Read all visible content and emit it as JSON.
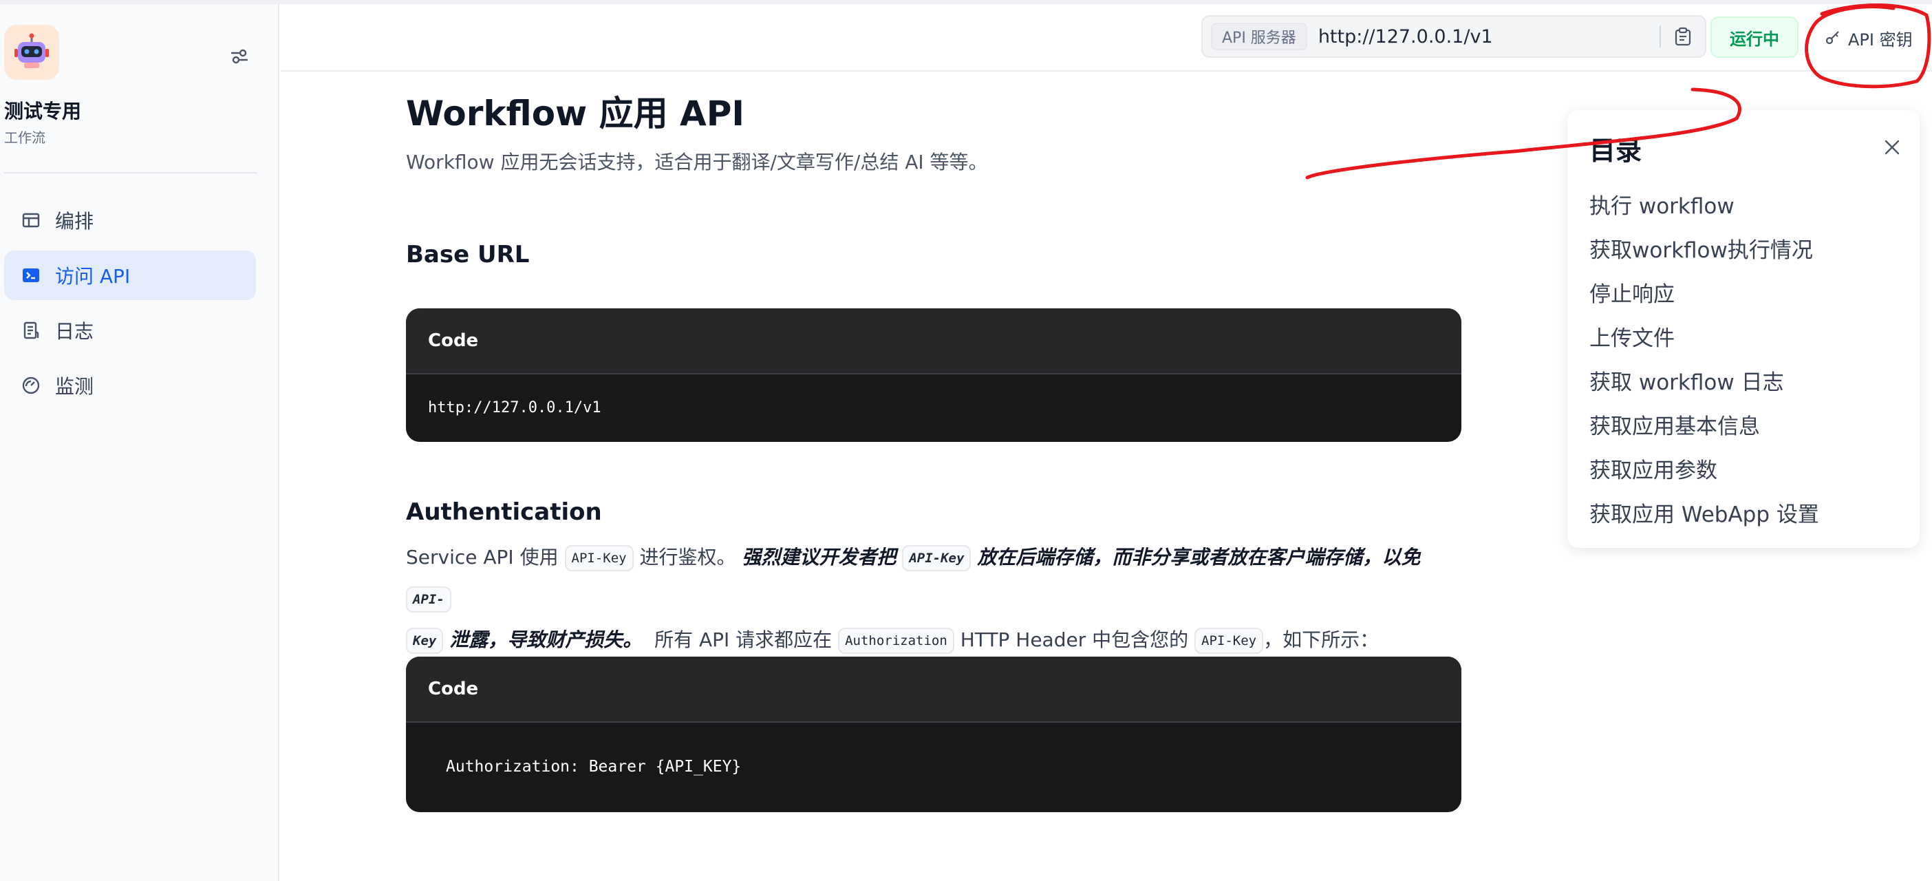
{
  "app": {
    "name": "测试专用",
    "type": "工作流"
  },
  "nav": {
    "items": [
      {
        "label": "编排",
        "icon": "layout-icon"
      },
      {
        "label": "访问 API",
        "icon": "terminal-icon"
      },
      {
        "label": "日志",
        "icon": "document-icon"
      },
      {
        "label": "监测",
        "icon": "gauge-icon"
      }
    ],
    "active_index": 1
  },
  "header": {
    "server_tag": "API 服务器",
    "server_url": "http://127.0.0.1/v1",
    "status": "运行中",
    "api_key_label": "API 密钥"
  },
  "doc": {
    "title": "Workflow 应用 API",
    "subtitle": "Workflow 应用无会话支持，适合用于翻译/文章写作/总结 AI 等等。",
    "base_url": {
      "heading": "Base URL",
      "code_label": "Code",
      "code": "http://127.0.0.1/v1"
    },
    "auth": {
      "heading": "Authentication",
      "p1": "Service API 使用",
      "chip": "API-Key",
      "p2": "进行鉴权。",
      "em1": "强烈建议开发者把",
      "em2": "放在后端存储，而非分享或者放在客户端存储，以免",
      "chip_split_a": "API-",
      "chip_split_b": "Key",
      "em3": "泄露，导致财产损失。",
      "p3": "所有 API 请求都应在",
      "chip_auth": "Authorization",
      "p4": "HTTP Header 中包含您的",
      "p5": "，如下所示：",
      "code_label": "Code",
      "code": "Authorization: Bearer {API_KEY}"
    }
  },
  "toc": {
    "title": "目录",
    "items": [
      "执行 workflow",
      "获取workflow执行情况",
      "停止响应",
      "上传文件",
      "获取 workflow 日志",
      "获取应用基本信息",
      "获取应用参数",
      "获取应用 WebApp 设置"
    ]
  },
  "colors": {
    "accent": "#155eef",
    "status_green": "#039855",
    "annotation_red": "#e8171b"
  }
}
